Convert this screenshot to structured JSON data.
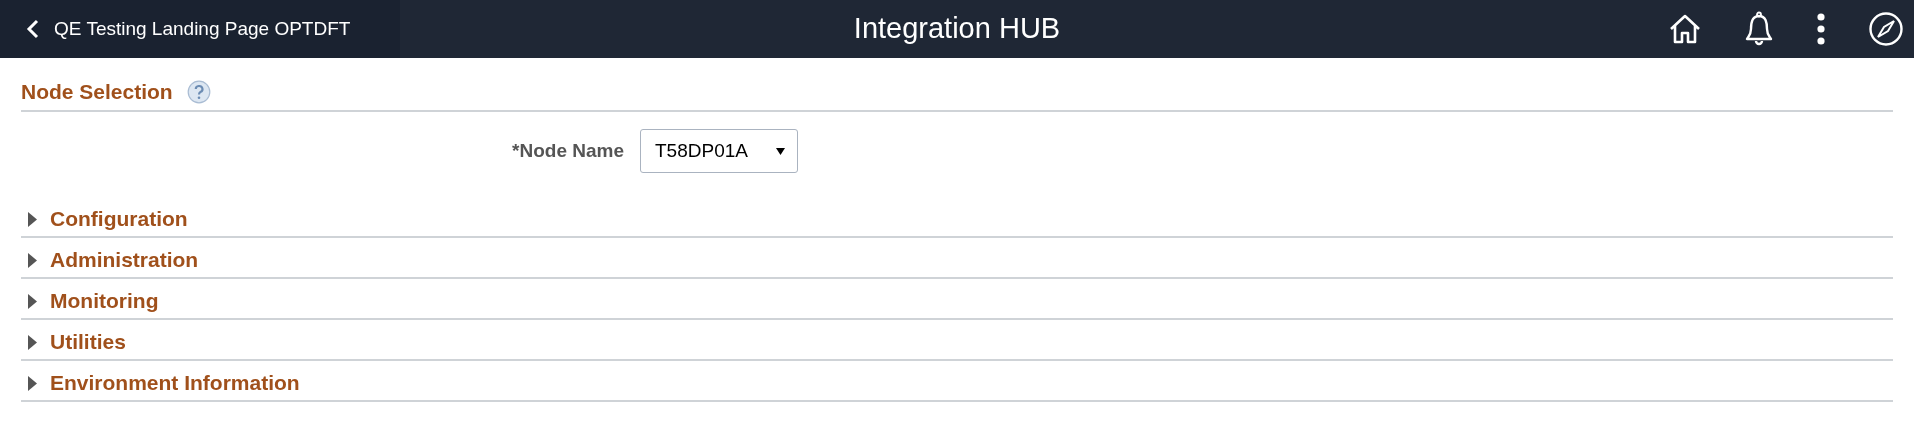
{
  "header": {
    "back_label": "QE Testing Landing Page OPTDFT",
    "title": "Integration HUB"
  },
  "node_selection": {
    "title": "Node Selection",
    "field_label": "*Node Name",
    "value": "T58DP01A"
  },
  "sections": [
    {
      "label": "Configuration",
      "expanded": false
    },
    {
      "label": "Administration",
      "expanded": false
    },
    {
      "label": "Monitoring",
      "expanded": false
    },
    {
      "label": "Utilities",
      "expanded": false
    },
    {
      "label": "Environment Information",
      "expanded": false
    }
  ]
}
